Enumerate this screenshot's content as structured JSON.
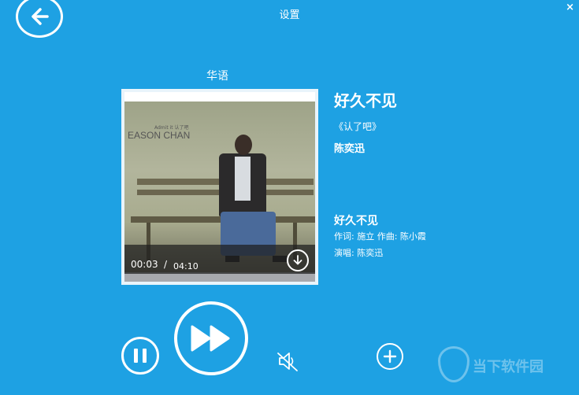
{
  "window": {
    "title": "设置",
    "close_label": "×"
  },
  "category": "华语",
  "player": {
    "current_time": "00:03",
    "time_separator": "/",
    "total_time": "04:10"
  },
  "song": {
    "title": "好久不见",
    "album": "《认了吧》",
    "artist": "陈奕迅"
  },
  "lyrics": {
    "title": "好久不见",
    "credits": "作词: 施立 作曲: 陈小霞",
    "singer": "演唱: 陈奕迅"
  },
  "cover": {
    "artist_text": "EASON CHAN",
    "small_text": "Admit it 认了吧"
  },
  "watermark": {
    "text": "当下软件园"
  },
  "icons": {
    "back": "back-arrow-icon",
    "close": "close-icon",
    "download": "download-icon",
    "pause": "pause-icon",
    "next": "fast-forward-icon",
    "mute": "speaker-mute-icon",
    "add": "plus-icon"
  },
  "colors": {
    "background": "#1ea1e3",
    "foreground": "#ffffff"
  }
}
